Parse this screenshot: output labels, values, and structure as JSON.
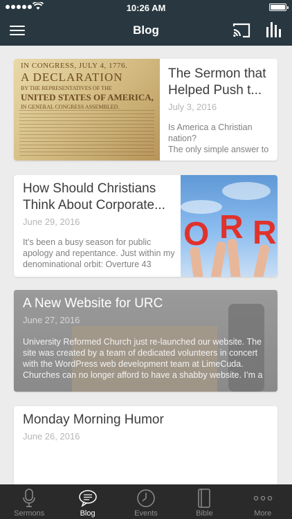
{
  "status": {
    "time": "10:26 AM"
  },
  "header": {
    "title": "Blog"
  },
  "posts": [
    {
      "title": "The Sermon that Helped Push t...",
      "date": "July 3, 2016",
      "excerpt": "Is America a Christian nation?\nThe only simple answer to",
      "image_text": {
        "l1": "IN CONGRESS, JULY 4, 1776.",
        "l2": "A DECLARATION",
        "l3": "BY THE REPRESENTATIVES OF THE",
        "l4": "UNITED STATES OF AMERICA,",
        "l5": "IN GENERAL CONGRESS ASSEMBLED."
      }
    },
    {
      "title": "How Should Christians Think About Corporate...",
      "date": "June 29, 2016",
      "excerpt": "It’s been a busy season for public apology and repentance. Just within my denominational orbit: Overture 43",
      "image_letters": [
        "O",
        "R",
        "R"
      ]
    },
    {
      "title": "A New Website for URC",
      "date": "June 27, 2016",
      "excerpt": "University Reformed Church just re-launched our website. The site was created by a team of dedicated volunteers in concert with the WordPress web development team at LimeCuda. Churches can no longer afford to have a shabby website. I’m a"
    },
    {
      "title": "Monday Morning Humor",
      "date": "June 26, 2016",
      "excerpt": ""
    }
  ],
  "tabs": [
    {
      "label": "Sermons",
      "icon": "microphone-icon"
    },
    {
      "label": "Blog",
      "icon": "chat-bubble-icon"
    },
    {
      "label": "Events",
      "icon": "clock-icon"
    },
    {
      "label": "Bible",
      "icon": "book-icon"
    },
    {
      "label": "More",
      "icon": "more-dots-icon"
    }
  ],
  "colors": {
    "header": "#293840",
    "tabbar": "#2a2a2a",
    "active_tab": "#ffffff",
    "inactive_tab": "#8e8e8e"
  }
}
